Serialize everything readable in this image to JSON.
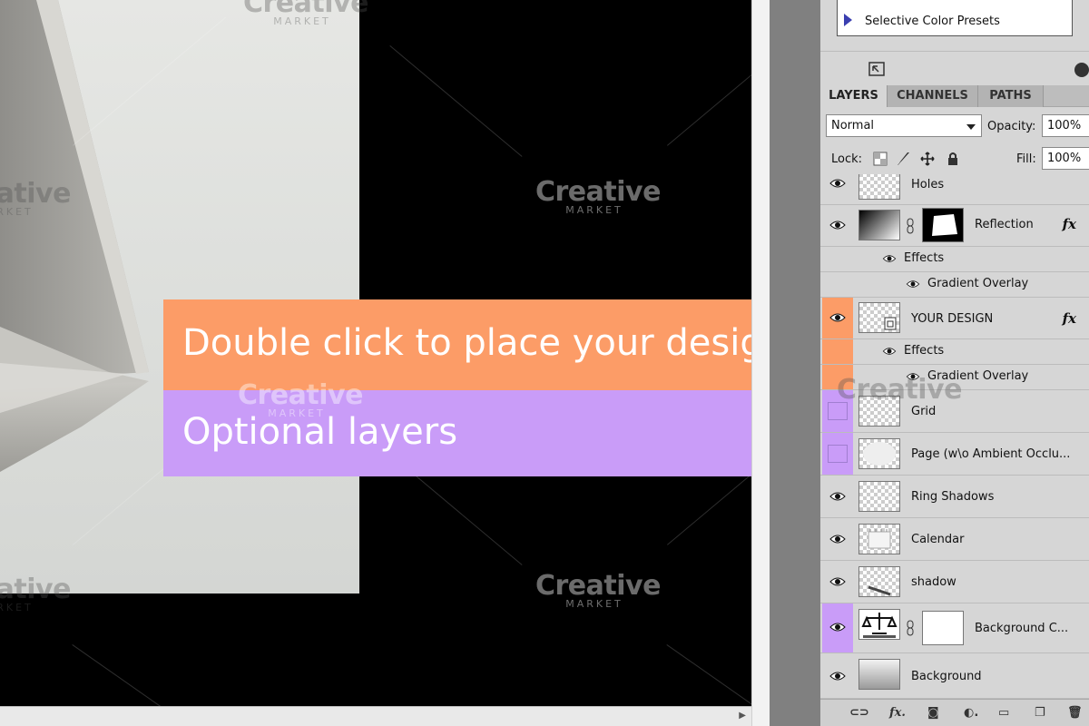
{
  "banners": {
    "primary": "Double click to place your design",
    "secondary": "Optional layers"
  },
  "colors": {
    "banner_primary": "#fc9c67",
    "banner_secondary": "#c99cf8",
    "panel_bg": "#d6d6d6"
  },
  "watermark": {
    "brand": "Creative",
    "sub": "MARKET"
  },
  "adjustments": {
    "preset_label": "Selective Color Presets"
  },
  "layers_panel": {
    "tabs": [
      {
        "label": "LAYERS",
        "active": true
      },
      {
        "label": "CHANNELS",
        "active": false
      },
      {
        "label": "PATHS",
        "active": false
      }
    ],
    "blend_mode": "Normal",
    "opacity_label": "Opacity:",
    "opacity_value": "100%",
    "lock_label": "Lock:",
    "fill_label": "Fill:",
    "fill_value": "100%",
    "layers": [
      {
        "name": "Holes",
        "visible": true
      },
      {
        "name": "Reflection",
        "visible": true,
        "fx": "fx",
        "effects_label": "Effects",
        "effect": "Gradient Overlay"
      },
      {
        "name": "YOUR DESIGN",
        "visible": true,
        "highlight": "orange",
        "fx": "fx",
        "effects_label": "Effects",
        "effect": "Gradient Overlay"
      },
      {
        "name": "Grid",
        "visible": false,
        "highlight": "purple"
      },
      {
        "name": "Page (w\\o Ambient Occlu...",
        "visible": false,
        "highlight": "purple"
      },
      {
        "name": "Ring Shadows",
        "visible": true
      },
      {
        "name": "Calendar",
        "visible": true
      },
      {
        "name": "shadow",
        "visible": true
      },
      {
        "name": "Background C...",
        "visible": true,
        "highlight": "purple"
      },
      {
        "name": "Background",
        "visible": true
      }
    ],
    "bottom_icons": [
      "link-icon",
      "fx-icon",
      "mask-icon",
      "adjustment-icon",
      "folder-icon",
      "new-layer-icon",
      "trash-icon"
    ]
  }
}
